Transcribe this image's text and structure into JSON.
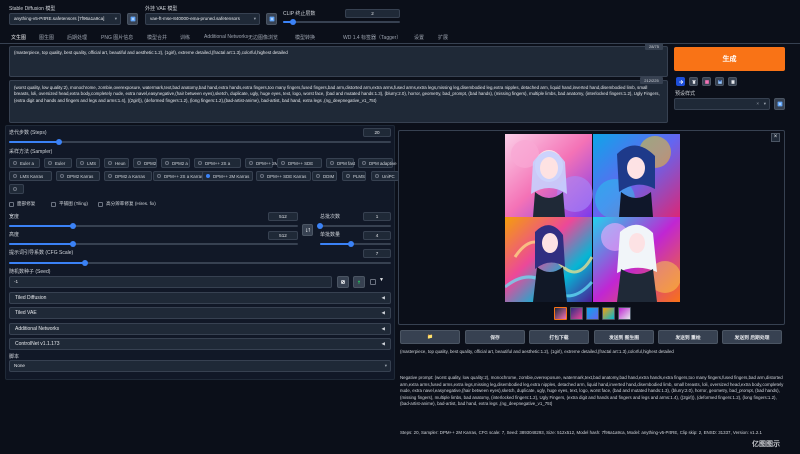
{
  "header": {
    "model_label": "Stable Diffusion 模型",
    "model_value": "anything-v5-PrtRE.safetensors [7f96a1a9ca]",
    "vae_label": "外挂 VAE 模型",
    "vae_value": "vae-ft-mse-840000-ema-pruned.safetensors",
    "clip_label": "CLIP 终止层数",
    "clip_value": "2",
    "clip_fraction": 0.083
  },
  "tabs": [
    "文生图",
    "图生图",
    "后期处理",
    "PNG 图片信息",
    "模型合并",
    "训练",
    "Additional Networks",
    "无边图像浏览",
    "模型转换",
    "WD 1.4 标签器（Tagger）",
    "设置",
    "扩展"
  ],
  "prompt": {
    "positive": "(masterpiece, top quality, best quality, official art, beautiful and aesthetic:1.2), (1girl), extreme detailed,(fractal art:1.3),colorful,highest detailed",
    "positive_count": "28/75",
    "negative": "(worst quality, low quality:2), monochrome, zombie,overexposure, watermark,text,bad anatomy,bad hand,extra hands,extra fingers,too many fingers,fused fingers,bad arm,distorted arm,extra arms,fused arms,extra legs,missing leg,disembodied leg,extra nipples, detached arm, liquid hand,inverted hand,disembodied limb, small breasts, loli, oversized head,extra body,completely nude, extra navel,easynegative,(hair between eyes),sketch, duplicate, ugly, huge eyes, text, logo, worst face, (bad and mutated hands:1.3), (blurry:2.0), horror, geometry, bad_prompt, (bad hands), (missing fingers), multiple limbs, bad anatomy, (interlocked fingers:1.2), Ugly Fingers, (extra digit and hands and fingers and legs and arms:1.4), ((2girl)), (deformed fingers:1.2), (long fingers:1.2),(bad-artist-anime), bad-artist, bad hand, extra legs ,(ng_deepnegative_v1_75t)",
    "negative_count": "212/225"
  },
  "generate": {
    "label": "生成",
    "style_label": "预设样式",
    "color": "#f97316"
  },
  "sampling": {
    "steps_label": "迭代步数 (Steps)",
    "steps_value": "20",
    "steps_fraction": 0.13,
    "method_label": "采样方法 (Sampler)",
    "methods": [
      "Euler a",
      "Euler",
      "LMS",
      "Heun",
      "DPM2",
      "DPM2 a",
      "DPM++ 2S a",
      "DPM++ 2M",
      "DPM++ SDE",
      "DPM fast",
      "DPM adaptive",
      "LMS Karras",
      "DPM2 Karras",
      "DPM2 a Karras",
      "DPM++ 2S a Karras",
      "DPM++ 2M Karras",
      "DPM++ SDE Karras",
      "DDIM",
      "PLMS",
      "UniPC"
    ],
    "selected": "DPM++ 2M Karras"
  },
  "options": {
    "face_restore": "面部修复",
    "tiling": "平铺图 (Tiling)",
    "hires": "高分辨率修复 (Hires. fix)"
  },
  "size": {
    "width_label": "宽度",
    "width_value": "512",
    "width_fraction": 0.22,
    "height_label": "高度",
    "height_value": "512",
    "height_fraction": 0.22,
    "batch_count_label": "总批次数",
    "batch_count_value": "1",
    "batch_count_fraction": 0.0,
    "batch_size_label": "单批数量",
    "batch_size_value": "4",
    "batch_size_fraction": 0.43
  },
  "cfg": {
    "label": "提示词引导系数 (CFG Scale)",
    "value": "7",
    "fraction": 0.2
  },
  "seed": {
    "label": "随机数种子 (Seed)",
    "value": "-1"
  },
  "accordions": [
    "Tiled Diffusion",
    "Tiled VAE",
    "Additional Networks",
    "ControlNet v1.1.173"
  ],
  "script": {
    "label": "脚本",
    "value": "None"
  },
  "gallery": {
    "thumb_count": 5
  },
  "actions": [
    "📁",
    "保存",
    "打包下载",
    "发送到 图生图",
    "发送到 重绘",
    "发送到 后期处理"
  ],
  "output": {
    "prompt": "(masterpiece, top quality, best quality, official art, beautiful and aesthetic:1.2), (1girl), extreme detailed,(fractal art:1.3),colorful,highest detailed",
    "negative": "Negative prompt: (worst quality, low quality:2), monochrome, zombie,overexposure, watermark,text,bad anatomy,bad hand,extra hands,extra fingers,too many fingers,fused fingers,bad arm,distorted arm,extra arms,fused arms,extra legs,missing leg,disembodied leg,extra nipples, detached arm, liquid hand,inverted hand,disembodied limb, small breasts, loli, oversized head,extra body,completely nude, extra navel,easynegative,(hair between eyes),sketch, duplicate, ugly, huge eyes, text, logo, worst face, (bad and mutated hands:1.3), (blurry:2.0), horror, geometry, bad_prompt, (bad hands), (missing fingers), multiple limbs, bad anatomy, (interlocked fingers:1.2), Ugly Fingers, (extra digit and hands and fingers and legs and arms:1.4), ((2girl)), (deformed fingers:1.2), (long fingers:1.2),(bad-artist-anime), bad-artist, bad hand, extra legs ,(ng_deepnegative_v1_75t)",
    "params": "Steps: 20, Sampler: DPM++ 2M Karras, CFG scale: 7, Seed: 3893048293, Size: 512x512, Model hash: 7f96a1a9ca, Model: anything-v5-PrtRE, Clip skip: 2, ENSD: 31337, Version: v1.2.1"
  },
  "watermark": "亿图图示"
}
